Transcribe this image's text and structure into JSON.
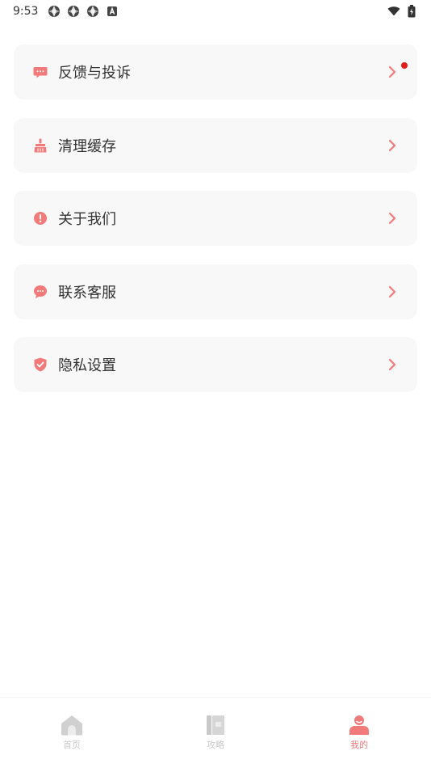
{
  "status_bar": {
    "time": "9:53",
    "left_icons": [
      "aperture-icon",
      "aperture-icon",
      "aperture-icon",
      "a-box-icon"
    ],
    "right_icons": [
      "wifi-icon",
      "battery-icon"
    ]
  },
  "colors": {
    "accent": "#f37a7a",
    "item_bg": "#f8f8f8",
    "badge": "#e0201c",
    "inactive": "#c9c9c9"
  },
  "menu": {
    "items": [
      {
        "label": "反馈与投诉",
        "icon": "chat-bubble-icon",
        "has_badge": true
      },
      {
        "label": "清理缓存",
        "icon": "broom-icon",
        "has_badge": false
      },
      {
        "label": "关于我们",
        "icon": "info-circle-icon",
        "has_badge": false
      },
      {
        "label": "联系客服",
        "icon": "service-chat-icon",
        "has_badge": false
      },
      {
        "label": "隐私设置",
        "icon": "shield-icon",
        "has_badge": false
      }
    ]
  },
  "bottom_nav": {
    "tabs": [
      {
        "label": "首页",
        "icon": "home-icon",
        "active": false
      },
      {
        "label": "攻略",
        "icon": "guide-book-icon",
        "active": false
      },
      {
        "label": "我的",
        "icon": "profile-icon",
        "active": true
      }
    ]
  }
}
